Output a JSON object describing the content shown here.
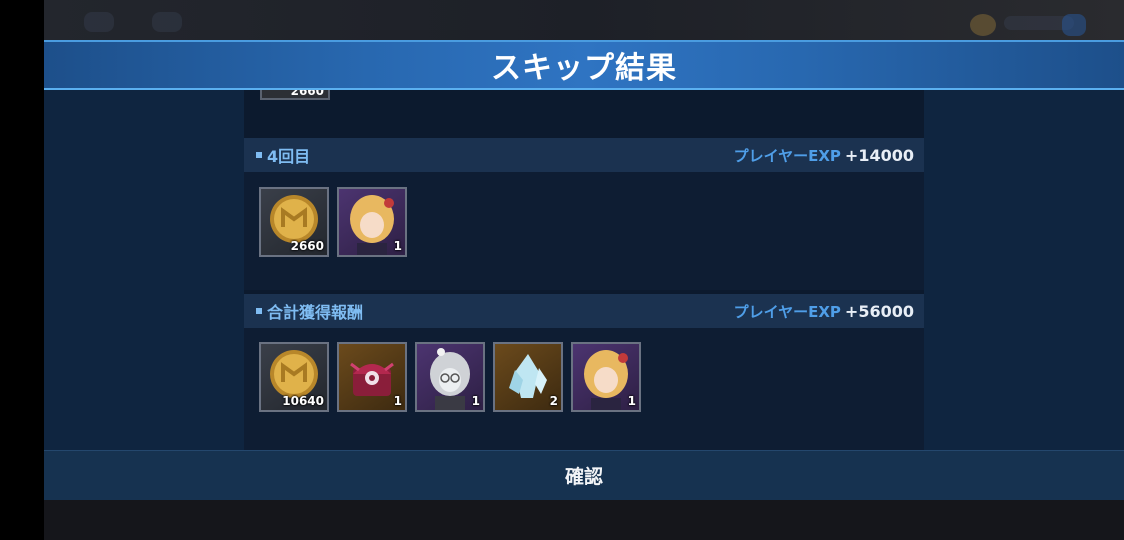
{
  "header": {
    "title": "スキップ結果"
  },
  "previous_round": {
    "partial_count": "2660"
  },
  "sections": [
    {
      "title": "4回目",
      "exp_label": "プレイヤーEXP",
      "exp_value": "+14000",
      "items": [
        {
          "icon": "gold-coin-icon",
          "count": "2660"
        },
        {
          "icon": "character-portrait-blonde-icon",
          "count": "1"
        }
      ]
    },
    {
      "title": "合計獲得報酬",
      "exp_label": "プレイヤーEXP",
      "exp_value": "+56000",
      "items": [
        {
          "icon": "gold-coin-icon",
          "count": "10640"
        },
        {
          "icon": "treasure-chest-icon",
          "count": "1"
        },
        {
          "icon": "character-portrait-silver-icon",
          "count": "1"
        },
        {
          "icon": "crystal-icon",
          "count": "2"
        },
        {
          "icon": "character-portrait-blonde-icon",
          "count": "1"
        }
      ]
    }
  ],
  "footer": {
    "confirm_label": "確認"
  },
  "colors": {
    "accent_blue": "#2f74c2",
    "label_blue": "#7fbcf2",
    "exp_blue": "#4f9ee8"
  }
}
